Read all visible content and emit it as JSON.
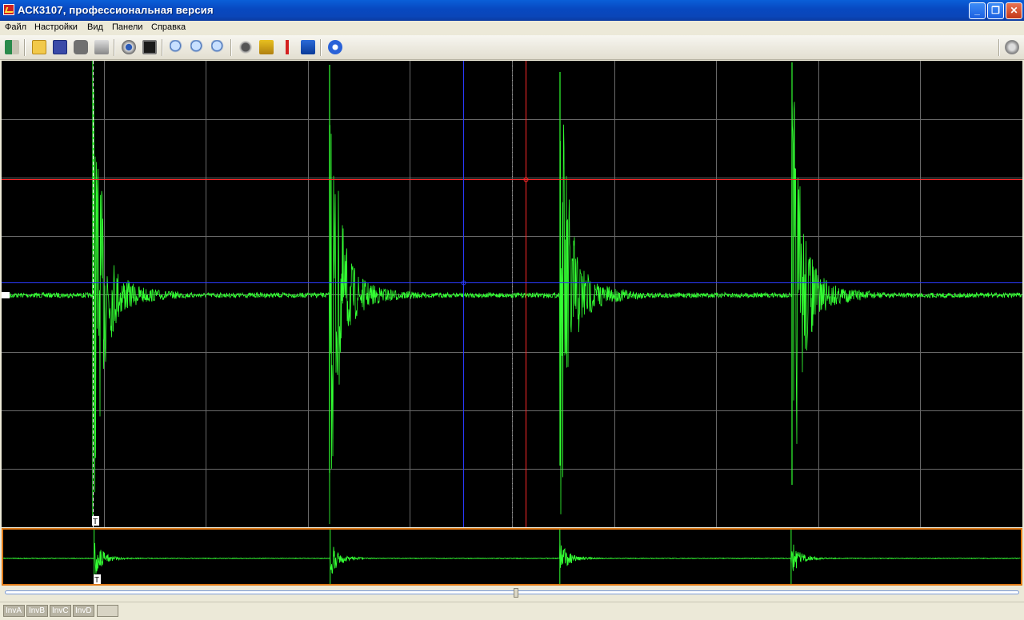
{
  "window": {
    "title": "АСК3107, профессиональная версия",
    "minimize_label": "_",
    "restore_label": "❐",
    "close_label": "✕"
  },
  "menu": {
    "items": [
      "Файл",
      "Настройки",
      "Вид",
      "Панели",
      "Справка"
    ]
  },
  "toolbar": {
    "icons": [
      "exit-icon",
      "open-folder-icon",
      "save-icon",
      "screenshot-icon",
      "print-icon",
      "eye-icon",
      "monitor-icon",
      "zoom-in-icon",
      "zoom-icon",
      "zoom-out-icon",
      "gear-icon",
      "cursor-tool-icon",
      "marker-icon",
      "measure-icon",
      "help-icon",
      "settings-round-icon"
    ]
  },
  "scope": {
    "trigger_marker": "T",
    "colors": {
      "background": "#000000",
      "grid": "#6a6a6a",
      "trace": "#33ff33",
      "cursor_red": "#ff2a2a",
      "cursor_blue": "#2a3aff"
    }
  },
  "overview": {
    "trigger_marker": "T",
    "border_color": "#e07b18"
  },
  "scrollbar": {
    "position": 0.5
  },
  "statusbar": {
    "buttons": [
      "InvA",
      "InvB",
      "InvC",
      "InvD"
    ]
  }
}
